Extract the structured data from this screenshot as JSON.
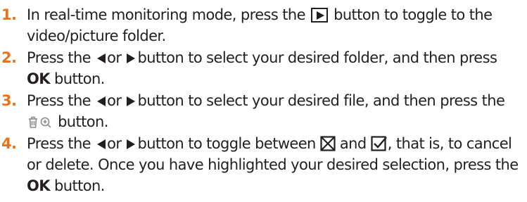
{
  "steps": [
    {
      "number": "1.",
      "parts": {
        "a": "In real-time monitoring mode, press the",
        "b": "button to toggle to the video/picture folder."
      },
      "icons": [
        "play-button-icon"
      ]
    },
    {
      "number": "2.",
      "parts": {
        "a": "Press the",
        "b": "or",
        "c": "button to select your desired folder, and then press",
        "bold1": "OK",
        "d": "button."
      },
      "icons": [
        "left-arrow-icon",
        "right-arrow-icon"
      ]
    },
    {
      "number": "3.",
      "parts": {
        "a": "Press the",
        "b": "or",
        "c": "button to select your desired file, and then press the",
        "d": "button."
      },
      "icons": [
        "left-arrow-icon",
        "right-arrow-icon",
        "delete-zoom-icon"
      ]
    },
    {
      "number": "4.",
      "parts": {
        "a": "Press the",
        "b": "or",
        "c": "button to toggle between",
        "d": "and",
        "e": ", that is, to cancel or delete. Once you have highlighted your desired selection, press the",
        "bold1": "OK",
        "f": "button."
      },
      "icons": [
        "left-arrow-icon",
        "right-arrow-icon",
        "cancel-box-icon",
        "confirm-box-icon"
      ]
    }
  ],
  "colors": {
    "text": "#231f20",
    "step_number": "#e8731a"
  }
}
